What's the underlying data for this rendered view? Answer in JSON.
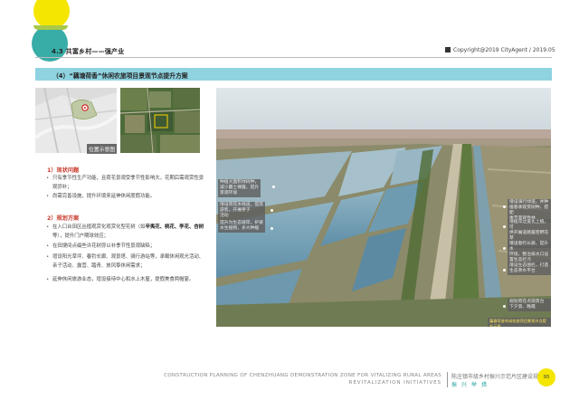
{
  "header": {
    "section_title": "4.3 共富乡村——强产业",
    "copyright": "Copyright@2019 CityAgent / 2019.05"
  },
  "banner": {
    "title": "（4）“藕塘荷香”休闲农旅项目景观节点提升方案"
  },
  "map": {
    "caption": "位置示意图"
  },
  "status": {
    "heading": "1）现状问题",
    "items": [
      "只有季节性生产功能，且荷花景观受季节性影响大，花期后需观赏性景观弥补；",
      "尚需完善设施，提升环境来延伸休闲度假功能。"
    ]
  },
  "plan": {
    "heading": "2）规划方案",
    "item1_pre": "在入口台田区丛植观赏化观赏化型花树（如",
    "item1_bold": "辛夷花、桃花、李花、杏树",
    "item1_post": "等），提升门户期球效应；",
    "items": [
      "在田埂间点缀些许花树弥以补季节性景观缺陷；",
      "增设阳光草坪、春钓长廊、观景塔、骑行游站等，承载休闲观光活动、亲子活动、露营、踏青、放风筝休闲需求；",
      "延伸休闲旅游业态，增设接待中心和水上木屋，提假美食两帽宴。"
    ]
  },
  "photo": {
    "labels": [
      "种植大面积绿树种，\n减少霸土裸露，提升\n景观环境",
      "增设荷花木栈道，提高\n游客，开展亲子\n活动",
      "提升为生态坡岸，护坡\n水生植物，多大种植",
      "增设骑行绿道，并种\n植春季观赏树种，搭配\n季节景观性林",
      "增植岸边宽化上植，可\n供开展道路露营野花草\n类活动",
      "增设春钓长廊，提升水\n环境，整治排水口设\n置生态拦污",
      "增设生态围栏，打造\n生态亲水平台",
      "规划荷花点观景台\n下夕景、晚霞"
    ],
    "bottom_label": "藕塘荷香休闲农旅项目景观节点提升示意"
  },
  "footer": {
    "line1": "CONSTRUCTION PLANNING OF CHENZHUANG DEMONSTRATION ZONE FOR VITALIZING RURAL AREAS",
    "line2": "REVITALIZATION INITIATIVES",
    "cn_title": "陈庄镇市级乡村振兴示范片区建设规划",
    "cn_sub": "振兴举措",
    "page": "95"
  },
  "colors": {
    "accent_yellow": "#f4e600",
    "accent_teal": "#27a5a0",
    "banner_blue": "#8fd3e0",
    "heading_red": "#c83a2b"
  }
}
